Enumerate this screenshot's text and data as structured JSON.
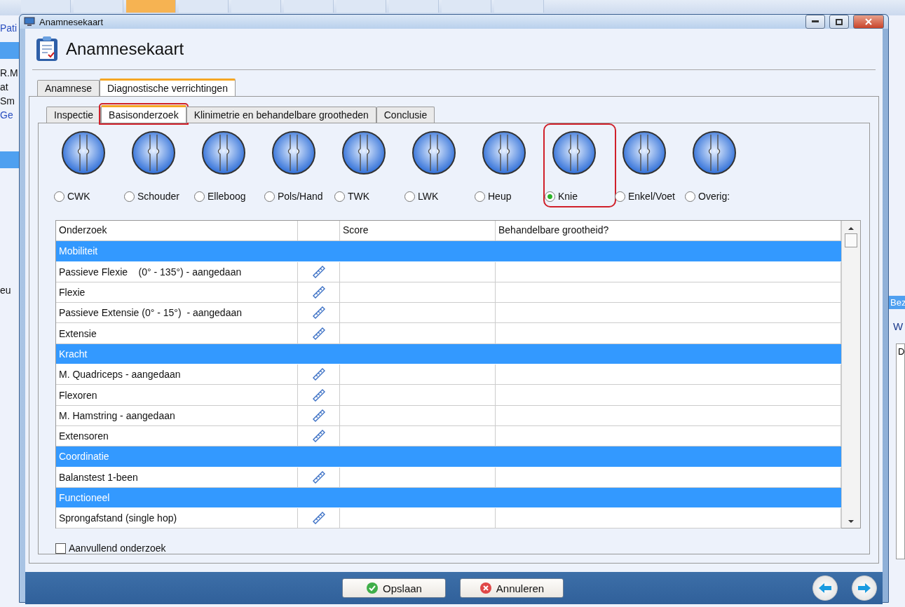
{
  "background_app": {
    "left_fragments": [
      "Pati",
      "R.M",
      "at",
      "Sm",
      "Ge",
      "eu"
    ],
    "right_fragments": [
      {
        "kind": "header",
        "text": "Bez"
      },
      {
        "kind": "label",
        "text": "W"
      },
      {
        "kind": "cell",
        "text": "D"
      }
    ]
  },
  "window": {
    "title": "Anamnesekaart",
    "heading": "Anamnesekaart"
  },
  "tabs": [
    {
      "label": "Anamnese",
      "selected": false
    },
    {
      "label": "Diagnostische verrichtingen",
      "selected": true
    }
  ],
  "subtabs": [
    {
      "label": "Inspectie",
      "selected": false,
      "highlighted": false
    },
    {
      "label": "Basisonderzoek",
      "selected": true,
      "highlighted": true
    },
    {
      "label": "Klinimetrie en behandelbare grootheden",
      "selected": false,
      "highlighted": false
    },
    {
      "label": "Conclusie",
      "selected": false,
      "highlighted": false
    }
  ],
  "regions": [
    {
      "label": "CWK",
      "selected": false,
      "highlighted": false
    },
    {
      "label": "Schouder",
      "selected": false,
      "highlighted": false
    },
    {
      "label": "Elleboog",
      "selected": false,
      "highlighted": false
    },
    {
      "label": "Pols/Hand",
      "selected": false,
      "highlighted": false
    },
    {
      "label": "TWK",
      "selected": false,
      "highlighted": false
    },
    {
      "label": "LWK",
      "selected": false,
      "highlighted": false
    },
    {
      "label": "Heup",
      "selected": false,
      "highlighted": false
    },
    {
      "label": "Knie",
      "selected": true,
      "highlighted": true
    },
    {
      "label": "Enkel/Voet",
      "selected": false,
      "highlighted": false
    },
    {
      "label": "Overig:",
      "selected": false,
      "highlighted": false
    }
  ],
  "table": {
    "columns": [
      "Onderzoek",
      "Score",
      "Behandelbare grootheid?"
    ],
    "rows": [
      {
        "kind": "group",
        "label": "Mobiliteit"
      },
      {
        "kind": "test",
        "label": "Passieve Flexie    (0° - 135°) - aangedaan"
      },
      {
        "kind": "test",
        "label": "Flexie"
      },
      {
        "kind": "test",
        "label": "Passieve Extensie (0° - 15°)  - aangedaan"
      },
      {
        "kind": "test",
        "label": "Extensie"
      },
      {
        "kind": "group",
        "label": "Kracht"
      },
      {
        "kind": "test",
        "label": "M. Quadriceps - aangedaan"
      },
      {
        "kind": "test",
        "label": "Flexoren"
      },
      {
        "kind": "test",
        "label": "M. Hamstring - aangedaan"
      },
      {
        "kind": "test",
        "label": "Extensoren"
      },
      {
        "kind": "group",
        "label": "Coordinatie"
      },
      {
        "kind": "test",
        "label": "Balanstest 1-been"
      },
      {
        "kind": "group",
        "label": "Functioneel"
      },
      {
        "kind": "test",
        "label": "Sprongafstand (single hop)"
      }
    ]
  },
  "extra_check": {
    "label": "Aanvullend onderzoek",
    "checked": false
  },
  "buttons": [
    {
      "kind": "ok",
      "label": "Opslaan"
    },
    {
      "kind": "cancel",
      "label": "Annuleren"
    }
  ]
}
